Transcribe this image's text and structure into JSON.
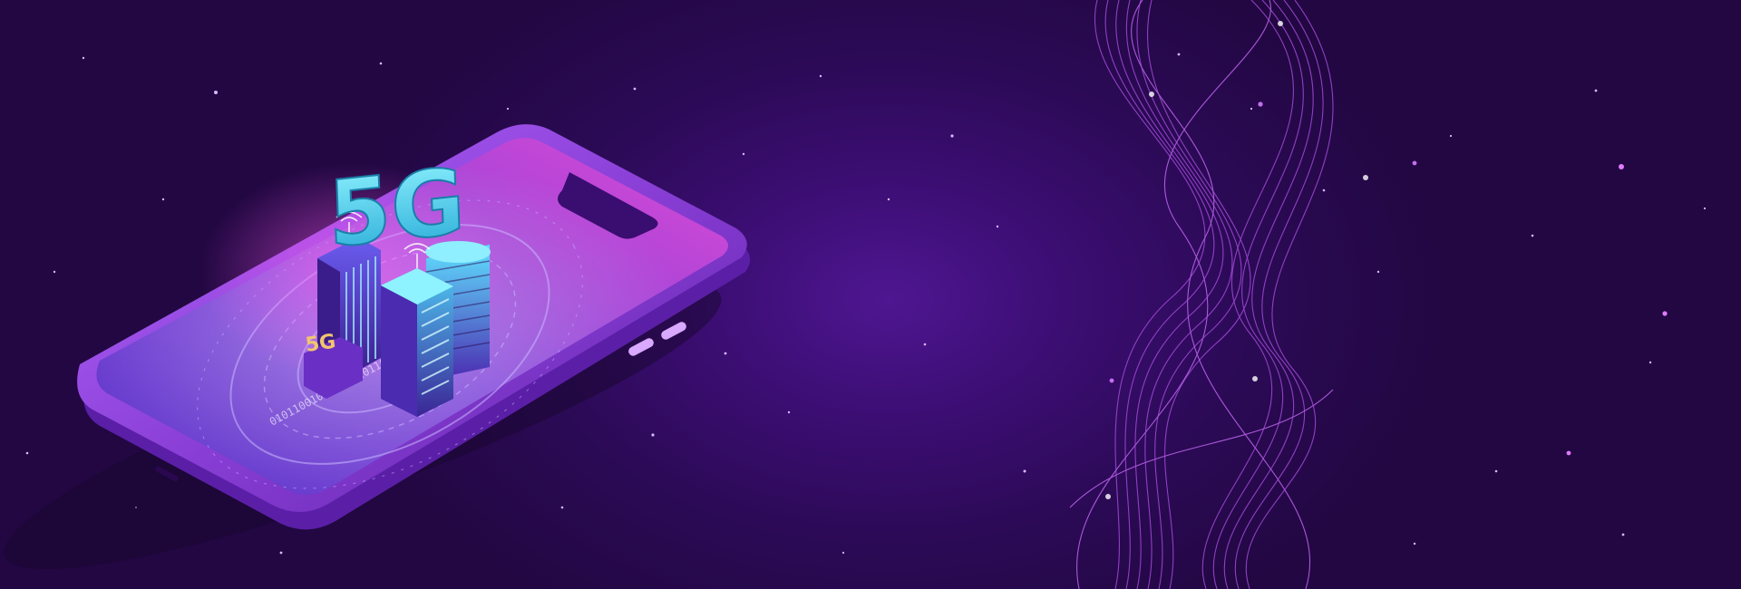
{
  "scene": {
    "type": "isometric-illustration",
    "subject": "smartphone-with-city-towers",
    "badge_large": "5G",
    "badge_small": "5G",
    "binary_ring_text": "0101100101011001011010010110",
    "colors": {
      "background": "#2b0a55",
      "background_center": "#4e1691",
      "phone_frame": "#8a3fd6",
      "phone_screen": "#b43ad8",
      "accent_cyan": "#3fd6f0",
      "accent_gold": "#f2c66d",
      "wave_lines": "#a14ad6"
    },
    "icons": [
      "smartphone-icon",
      "signal-antenna-icon",
      "building-icon",
      "wave-lines-icon"
    ]
  }
}
